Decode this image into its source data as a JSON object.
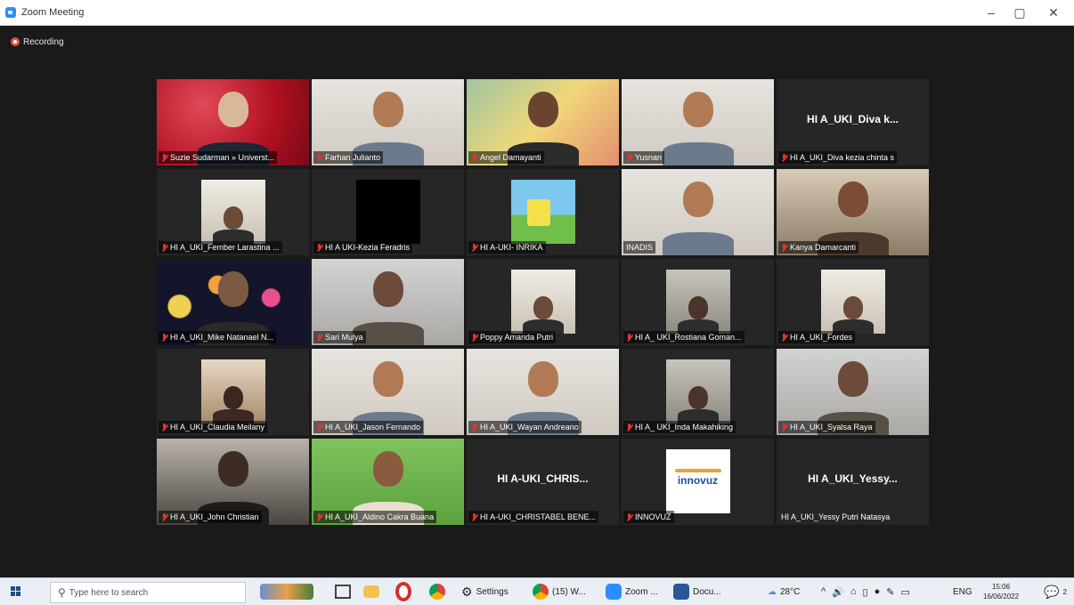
{
  "window": {
    "title": "Zoom Meeting",
    "controls": {
      "minimize": "–",
      "restore": "▢",
      "close": "✕"
    }
  },
  "recording_label": "Recording",
  "participants": [
    {
      "name": "Suzie Sudarman » Universt...",
      "muted": true,
      "video": "red-flowers"
    },
    {
      "name": "Farhan Julianto",
      "muted": true,
      "video": "person-light"
    },
    {
      "name": "Angel Damayanti",
      "muted": true,
      "video": "person-colorful"
    },
    {
      "name": "Yusnan",
      "muted": true,
      "video": "person-light"
    },
    {
      "name": "HI A_UKI_Diva kezia chinta s",
      "muted": true,
      "video": "off",
      "big_label": "HI A_UKI_Diva k..."
    },
    {
      "name": "HI A_UKI_Fember Larastina ...",
      "muted": true,
      "video": "small-light"
    },
    {
      "name": "HI A UKI-Kezia Feradris",
      "muted": true,
      "video": "black"
    },
    {
      "name": "HI A-UKI- INRIKA",
      "muted": true,
      "video": "cartoon"
    },
    {
      "name": "INADIS",
      "muted": false,
      "video": "person-light",
      "active": true
    },
    {
      "name": "Kanya Damarcanti",
      "muted": true,
      "video": "person-warm"
    },
    {
      "name": "HI A_UKI_Mike Natanael N...",
      "muted": true,
      "video": "fireworks"
    },
    {
      "name": "Sari Mulya",
      "muted": true,
      "video": "person-grey"
    },
    {
      "name": "Poppy Amanda Putri",
      "muted": true,
      "video": "small-light"
    },
    {
      "name": "HI A_ UKI_Rostiana Goman...",
      "muted": true,
      "video": "small-grey"
    },
    {
      "name": "HI A_UKI_Fordes",
      "muted": true,
      "video": "small-light"
    },
    {
      "name": "HI A_UKI_Claudia Meilany",
      "muted": true,
      "video": "small-warm"
    },
    {
      "name": "HI A_UKI_Jason Fernando",
      "muted": true,
      "video": "person-light"
    },
    {
      "name": "HI A_UKI_Wayan Andreano",
      "muted": true,
      "video": "person-light"
    },
    {
      "name": "HI A_ UKI_Inda Makahiking",
      "muted": true,
      "video": "small-grey"
    },
    {
      "name": "HI A_UKI_Syalsa Raya",
      "muted": true,
      "video": "person-grey"
    },
    {
      "name": "HI A_UKI_John Christian",
      "muted": true,
      "video": "person-dark"
    },
    {
      "name": "HI A_UKI_Aldino Cakra Buana",
      "muted": true,
      "video": "person-green"
    },
    {
      "name": "HI A-UKI_CHRISTABEL BENE...",
      "muted": true,
      "video": "off",
      "big_label": "HI  A-UKI_CHRIS..."
    },
    {
      "name": "INNOVUZ",
      "muted": true,
      "video": "logo",
      "logo_text": "innovuz"
    },
    {
      "name": "HI A_UKI_Yessy Putri Natasya",
      "muted": false,
      "video": "off",
      "big_label": "HI  A_UKI_Yessy..."
    }
  ],
  "taskbar": {
    "search_placeholder": "Type here to search",
    "apps": [
      {
        "label": "Settings",
        "icon": "gear-icon"
      },
      {
        "label": "(15) W...",
        "icon": "chrome-icon"
      },
      {
        "label": "Zoom ...",
        "icon": "zoom-icon"
      },
      {
        "label": "Docu...",
        "icon": "word-icon"
      }
    ],
    "weather": "28°C",
    "language": "ENG",
    "time": "15:06",
    "date": "16/06/2022",
    "notification_count": "2"
  },
  "colors": {
    "accent": "#2d8cff",
    "active_speaker_border": "#c9d85b",
    "muted_icon": "#e0362e"
  }
}
